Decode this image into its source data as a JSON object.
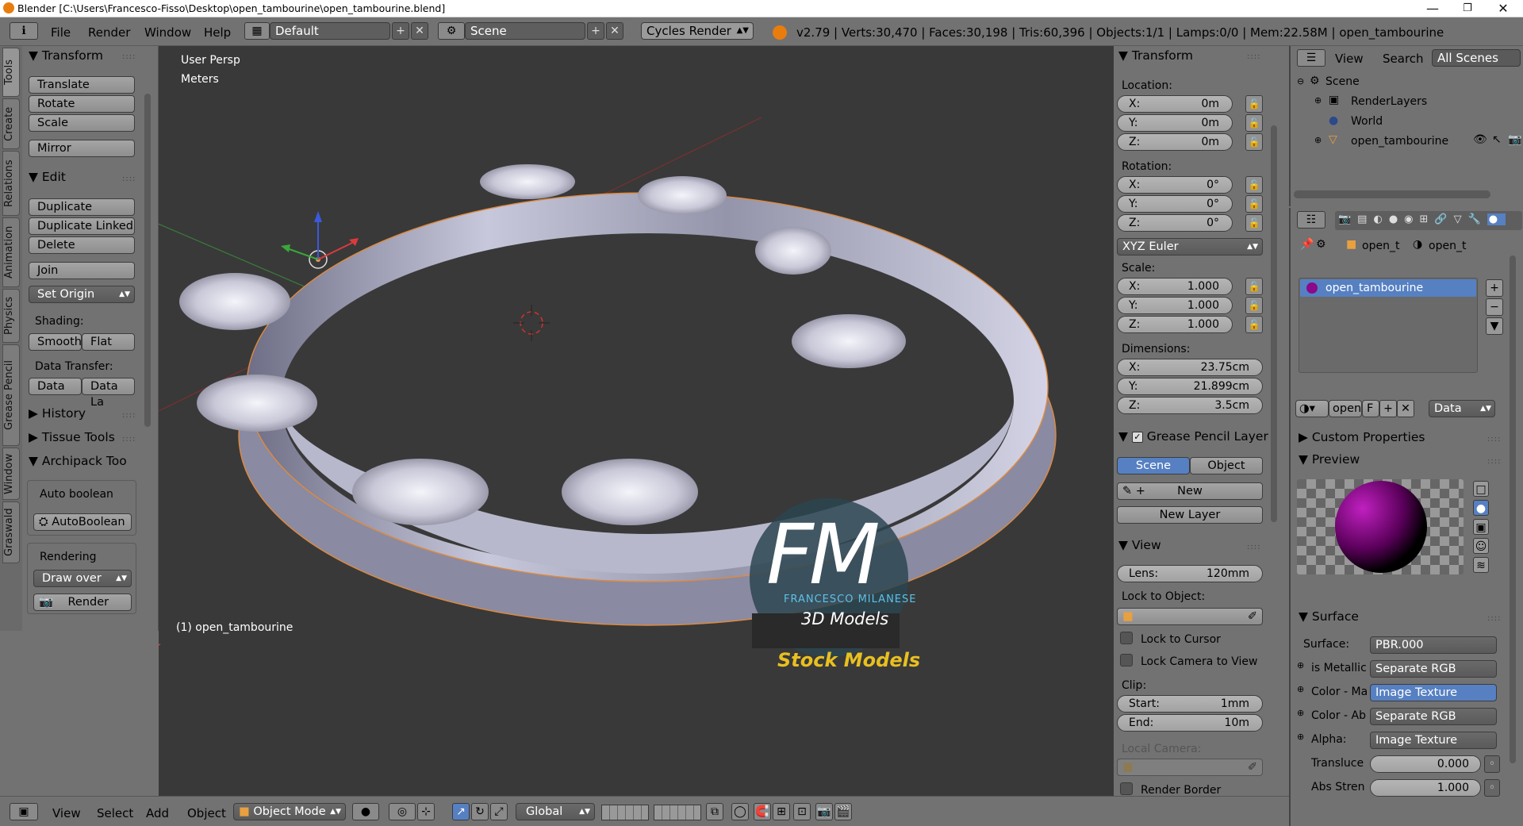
{
  "window": {
    "title": "Blender [C:\\Users\\Francesco-Fisso\\Desktop\\open_tambourine\\open_tambourine.blend]",
    "controls": [
      "—",
      "❐",
      "✕"
    ]
  },
  "header": {
    "menus": [
      "File",
      "Render",
      "Window",
      "Help"
    ],
    "screen_layout": "Default",
    "scene": "Scene",
    "render_engine": "Cycles Render",
    "stats": "v2.79 | Verts:30,470 | Faces:30,198 | Tris:60,396 | Objects:1/1 | Lamps:0/0 | Mem:22.58M | open_tambourine"
  },
  "tabs": [
    "Tools",
    "Create",
    "Relations",
    "Animation",
    "Physics",
    "Grease Pencil",
    "Window",
    "Graswald"
  ],
  "toolshelf": {
    "transform_title": "Transform",
    "translate": "Translate",
    "rotate": "Rotate",
    "scale": "Scale",
    "mirror": "Mirror",
    "edit_title": "Edit",
    "duplicate": "Duplicate",
    "duplicate_linked": "Duplicate Linked",
    "delete": "Delete",
    "join": "Join",
    "set_origin": "Set Origin",
    "shading_label": "Shading:",
    "smooth": "Smooth",
    "flat": "Flat",
    "data_transfer_label": "Data Transfer:",
    "data": "Data",
    "data_layout": "Data La",
    "history": "History",
    "tissue_tools": "Tissue Tools",
    "archipack": "Archipack Too",
    "auto_boolean_label": "Auto boolean",
    "auto_boolean_btn": "AutoBoolean",
    "rendering_label": "Rendering",
    "draw_over": "Draw over",
    "render": "Render"
  },
  "viewport": {
    "view_name": "User Persp",
    "units": "Meters",
    "object_label": "(1) open_tambourine",
    "watermark_fm": "FM",
    "watermark_name": "FRANCESCO MILANESE",
    "watermark_3d": "3D Models",
    "stock": "Stock Models"
  },
  "nprops": {
    "transform_title": "Transform",
    "location_label": "Location:",
    "loc": [
      {
        "axis": "X:",
        "value": "0m"
      },
      {
        "axis": "Y:",
        "value": "0m"
      },
      {
        "axis": "Z:",
        "value": "0m"
      }
    ],
    "rotation_label": "Rotation:",
    "rot": [
      {
        "axis": "X:",
        "value": "0°"
      },
      {
        "axis": "Y:",
        "value": "0°"
      },
      {
        "axis": "Z:",
        "value": "0°"
      }
    ],
    "rotation_mode": "XYZ Euler",
    "scale_label": "Scale:",
    "scl": [
      {
        "axis": "X:",
        "value": "1.000"
      },
      {
        "axis": "Y:",
        "value": "1.000"
      },
      {
        "axis": "Z:",
        "value": "1.000"
      }
    ],
    "dimensions_label": "Dimensions:",
    "dim": [
      {
        "axis": "X:",
        "value": "23.75cm"
      },
      {
        "axis": "Y:",
        "value": "21.899cm"
      },
      {
        "axis": "Z:",
        "value": "3.5cm"
      }
    ],
    "gp_layer_title": "Grease Pencil Layer",
    "scene_tab": "Scene",
    "object_tab": "Object",
    "new": "New",
    "new_layer": "New Layer",
    "view_title": "View",
    "lens": "Lens:",
    "lens_value": "120mm",
    "lock_to_object": "Lock to Object:",
    "lock_to_cursor": "Lock to Cursor",
    "lock_camera": "Lock Camera to View",
    "clip_label": "Clip:",
    "clip_start": "Start:",
    "clip_start_value": "1mm",
    "clip_end": "End:",
    "clip_end_value": "10m",
    "local_camera": "Local Camera:",
    "render_border": "Render Border"
  },
  "outliner": {
    "view": "View",
    "search": "Search",
    "filter": "All Scenes",
    "items": [
      "Scene",
      "RenderLayers",
      "World",
      "open_tambourine"
    ]
  },
  "properties": {
    "breadcrumb_1": "open_t",
    "breadcrumb_2": "open_t",
    "material_slot": "open_tambourine",
    "mat_name": "open",
    "mat_f": "F",
    "mat_link": "Data",
    "custom_props": "Custom Properties",
    "preview": "Preview",
    "surface_title": "Surface",
    "surface_label": "Surface:",
    "surface_value": "PBR.000",
    "rows": [
      {
        "label": "is Metallic",
        "value": "Separate RGB",
        "active": false
      },
      {
        "label": "Color - Ma",
        "value": "Image Texture",
        "active": true
      },
      {
        "label": "Color - Ab",
        "value": "Separate RGB",
        "active": false
      },
      {
        "label": "Alpha:",
        "value": "Image Texture",
        "active": false
      }
    ],
    "translucent_label": "Transluce",
    "translucent_value": "0.000",
    "abs_label": "Abs Stren",
    "abs_value": "1.000"
  },
  "bottombar": {
    "menus": [
      "View",
      "Select",
      "Add",
      "Object"
    ],
    "mode": "Object Mode",
    "orientation": "Global"
  }
}
